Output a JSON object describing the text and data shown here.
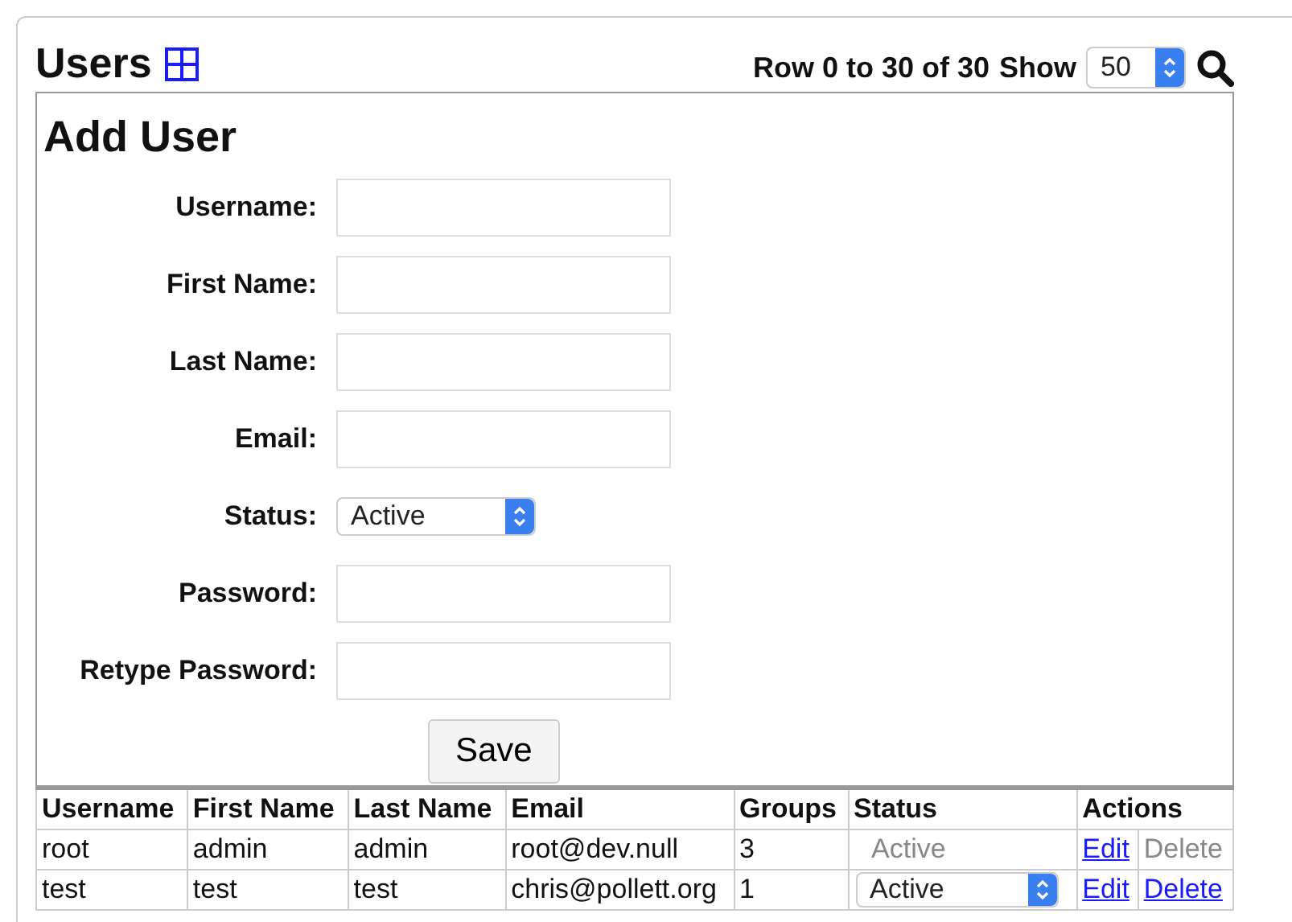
{
  "header": {
    "title": "Users",
    "pager": "Row 0 to 30 of 30",
    "show_label": "Show",
    "show_value": "50"
  },
  "form": {
    "title": "Add User",
    "fields": [
      {
        "label": "Username:",
        "kind": "text"
      },
      {
        "label": "First Name:",
        "kind": "text"
      },
      {
        "label": "Last Name:",
        "kind": "text"
      },
      {
        "label": "Email:",
        "kind": "text"
      },
      {
        "label": "Status:",
        "kind": "select",
        "value": "Active"
      },
      {
        "label": "Password:",
        "kind": "password"
      },
      {
        "label": "Retype Password:",
        "kind": "password"
      }
    ],
    "save": "Save"
  },
  "table": {
    "columns": [
      "Username",
      "First Name",
      "Last Name",
      "Email",
      "Groups",
      "Status",
      "Actions"
    ],
    "rows": [
      {
        "cells": [
          "root",
          "admin",
          "admin",
          "root@dev.null",
          "3"
        ],
        "status": "Active",
        "status_editable": false,
        "edit": "Edit",
        "delete": "Delete",
        "delete_disabled": true
      },
      {
        "cells": [
          "test",
          "test",
          "test",
          "chris@pollett.org",
          "1"
        ],
        "status": "Active",
        "status_editable": true,
        "edit": "Edit",
        "delete": "Delete",
        "delete_disabled": false
      }
    ]
  }
}
